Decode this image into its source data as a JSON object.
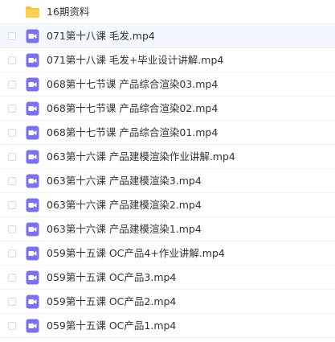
{
  "colors": {
    "folder": "#f8c33a",
    "video": "#7b6ff2",
    "highlight_row": "#f4f8fe"
  },
  "files": [
    {
      "name": "16期资料",
      "icon": "folder-icon",
      "type": "folder"
    },
    {
      "name": "071第十八课 毛发.mp4",
      "icon": "video-file-icon",
      "type": "video"
    },
    {
      "name": "071第十八课 毛发+毕业设计讲解.mp4",
      "icon": "video-file-icon",
      "type": "video"
    },
    {
      "name": "068第十七节课 产品综合渲染03.mp4",
      "icon": "video-file-icon",
      "type": "video"
    },
    {
      "name": "068第十七节课 产品综合渲染02.mp4",
      "icon": "video-file-icon",
      "type": "video"
    },
    {
      "name": "068第十七节课 产品综合渲染01.mp4",
      "icon": "video-file-icon",
      "type": "video"
    },
    {
      "name": "063第十六课 产品建模渲染作业讲解.mp4",
      "icon": "video-file-icon",
      "type": "video"
    },
    {
      "name": "063第十六课 产品建模渲染3.mp4",
      "icon": "video-file-icon",
      "type": "video"
    },
    {
      "name": "063第十六课 产品建模渲染2.mp4",
      "icon": "video-file-icon",
      "type": "video"
    },
    {
      "name": "063第十六课 产品建模渲染1.mp4",
      "icon": "video-file-icon",
      "type": "video"
    },
    {
      "name": "059第十五课 OC产品4+作业讲解.mp4",
      "icon": "video-file-icon",
      "type": "video"
    },
    {
      "name": "059第十五课 OC产品3.mp4",
      "icon": "video-file-icon",
      "type": "video"
    },
    {
      "name": "059第十五课 OC产品2.mp4",
      "icon": "video-file-icon",
      "type": "video"
    },
    {
      "name": "059第十五课 OC产品1.mp4",
      "icon": "video-file-icon",
      "type": "video"
    }
  ]
}
